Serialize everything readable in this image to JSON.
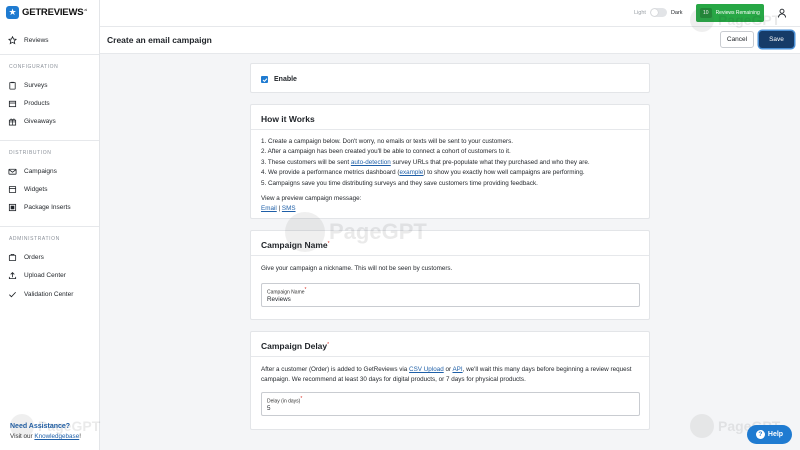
{
  "app": {
    "logo_text": "GETREVIEWS",
    "logo_sup": ".ai"
  },
  "topbar": {
    "theme_light": "Light",
    "theme_dark": "Dark",
    "reviews_count": "10",
    "reviews_label": "Reviews Remaining"
  },
  "sidebar": {
    "top_item": "Reviews",
    "configuration_title": "CONFIGURATION",
    "configuration_items": [
      "Surveys",
      "Products",
      "Giveaways"
    ],
    "distribution_title": "DISTRIBUTION",
    "distribution_items": [
      "Campaigns",
      "Widgets",
      "Package Inserts"
    ],
    "administration_title": "ADMINISTRATION",
    "administration_items": [
      "Orders",
      "Upload Center",
      "Validation Center"
    ]
  },
  "assist": {
    "title": "Need Assistance?",
    "text_prefix": "Visit our ",
    "link": "Knowledgebase",
    "text_suffix": "!"
  },
  "header": {
    "title": "Create an email campaign",
    "cancel_label": "Cancel",
    "save_label": "Save"
  },
  "enable": {
    "label": "Enable",
    "checked": true
  },
  "how_it_works": {
    "title": "How it Works",
    "steps": {
      "s1": "1. Create a campaign below. Don't worry, no emails or texts will be sent to your customers.",
      "s2": "2. After a campaign has been created you'll be able to connect a cohort of customers to it.",
      "s3_prefix": "3. These customers will be sent ",
      "s3_link": "auto-detection",
      "s3_suffix": " survey URLs that pre-populate what they purchased and who they are.",
      "s4_prefix": "4. We provide a performance metrics dashboard (",
      "s4_link": "example",
      "s4_suffix": ") to show you exactly how well campaigns are performing.",
      "s5": "5. Campaigns save you time distributing surveys and they save customers time providing feedback."
    },
    "preview_label": "View a preview campaign message:",
    "preview_email": "Email",
    "preview_sep": " | ",
    "preview_sms": "SMS"
  },
  "campaign_name": {
    "title": "Campaign Name",
    "required_mark": "*",
    "description": "Give your campaign a nickname. This will not be seen by customers.",
    "field_label": "Campaign Name",
    "field_value": "Reviews"
  },
  "campaign_delay": {
    "title": "Campaign Delay",
    "required_mark": "*",
    "desc_prefix": "After a customer (Order) is added to GetReviews via ",
    "desc_link1": "CSV Upload",
    "desc_or": " or ",
    "desc_link2": "API",
    "desc_suffix": ", we'll wait this many days before beginning a review request",
    "desc_line2": "campaign. We recommend at least 30 days for digital products, or 7 days for physical products.",
    "field_label": "Delay (in days)",
    "field_value": "5"
  },
  "help": {
    "label": "Help"
  },
  "watermark": {
    "text": "PageGPT"
  },
  "colors": {
    "primary": "#1f7bd1",
    "save_button": "#163b68",
    "reviews_badge": "#27a745",
    "required": "#d93025"
  }
}
